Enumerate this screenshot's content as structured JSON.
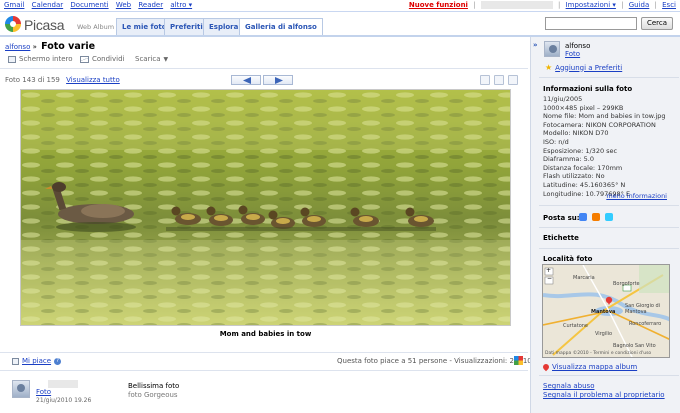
{
  "gbar": {
    "links": [
      "Gmail",
      "Calendar",
      "Documenti",
      "Web",
      "Reader",
      "altro ▾"
    ],
    "new_features": "Nuove funzioni",
    "settings": "Impostazioni ▾",
    "help": "Guida",
    "signout": "Esci"
  },
  "header": {
    "brand": "Picasa",
    "brand_sub": "Web Album",
    "tabs": [
      "Le mie foto",
      "Preferiti",
      "Esplora",
      "Galleria di alfonso"
    ],
    "active_tab": 3,
    "search_button": "Cerca",
    "search_value": ""
  },
  "breadcrumb": {
    "album_owner": "alfonso",
    "separator": "»",
    "album_title": "Foto varie"
  },
  "toolbar": {
    "slideshow": "Schermo intero",
    "share": "Condividi",
    "download": "Scarica"
  },
  "photo_nav": {
    "counter": "Foto 143 di 159",
    "view_all": "Visualizza tutto"
  },
  "photo": {
    "caption": "Mom and babies in tow"
  },
  "footer": {
    "like": "Mi piace",
    "stats": "Questa foto piace a 51 persone - Visualizzazioni: 25910"
  },
  "comment": {
    "author": "Foto",
    "date": "21/giu/2010 19.26",
    "text": "Bellissima foto",
    "from": "foto Gorgeous"
  },
  "sidebar": {
    "collapse": "»",
    "owner": "alfonso",
    "owner_sub": "Foto",
    "add_favorites": "Aggiungi a Preferiti",
    "info_title": "Informazioni sulla foto",
    "info": [
      "11/giu/2005",
      "1000×485 pixel – 299KB",
      "Nome file: Mom and babies in tow.jpg",
      "Fotocamera: NIKON CORPORATION",
      "Modello: NIKON D70",
      "ISO: n/d",
      "Esposizione: 1/320 sec",
      "Diaframma: 5.0",
      "Distanza focale: 170mm",
      "Flash utilizzato: No",
      "Latitudine: 45.160365° N",
      "Longitudine: 10.797698° E"
    ],
    "more_info": "meno informazioni",
    "post_to": "Posta su:",
    "tags": "Etichette",
    "location": "Località foto",
    "map_labels": [
      "Marcaria",
      "Borgoforte",
      "Mantova",
      "San Giorgio di Mantova",
      "Curtatone",
      "Virgilio",
      "Roncoferraro",
      "Bagnolo San Vito"
    ],
    "map_footer": "Dati mappa ©2010 - Termini e condizioni d'uso",
    "view_map": "Visualizza mappa album",
    "report_abuse": "Segnala abuso",
    "report_problem": "Segnala il problema al proprietario"
  }
}
